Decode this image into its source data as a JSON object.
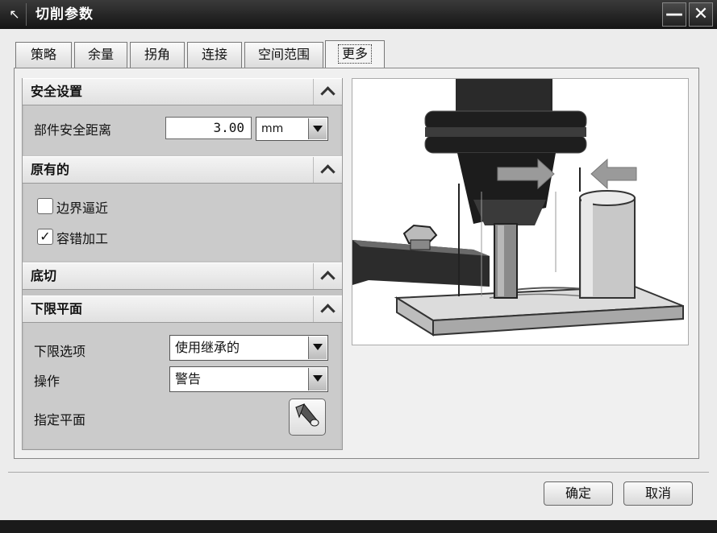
{
  "window": {
    "title": "切削参数",
    "title_icon": "arrow-icon",
    "minimize_label": "—",
    "close_label": "✕"
  },
  "tabs": [
    {
      "label": "策略"
    },
    {
      "label": "余量"
    },
    {
      "label": "拐角"
    },
    {
      "label": "连接"
    },
    {
      "label": "空间范围"
    },
    {
      "label": "更多",
      "active": true
    }
  ],
  "sections": {
    "safety": {
      "title": "安全设置",
      "part_clearance_label": "部件安全距离",
      "part_clearance_value": "3.00",
      "unit": "mm"
    },
    "original": {
      "title": "原有的",
      "boundary_approach_label": "边界逼近",
      "boundary_approach_checked": false,
      "tolerant_machining_label": "容错加工",
      "tolerant_machining_checked": true
    },
    "undercut": {
      "title": "底切"
    },
    "lower_limit": {
      "title": "下限平面",
      "option_label": "下限选项",
      "option_value": "使用继承的",
      "action_label": "操作",
      "action_value": "警告",
      "specify_plane_label": "指定平面"
    }
  },
  "buttons": {
    "ok": "确定",
    "cancel": "取消"
  },
  "colors": {
    "titlebar": "#1e1e1e",
    "panel": "#c4c4c4",
    "tool": "#2a2a2a",
    "arrow": "#9a9a9a"
  }
}
